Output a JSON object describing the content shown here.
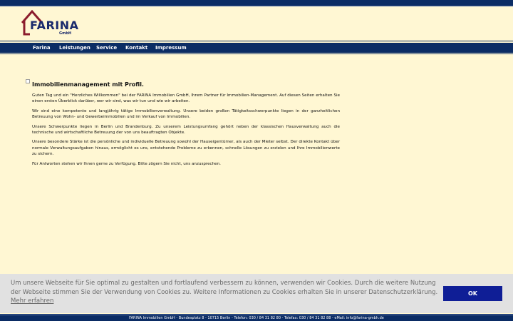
{
  "brand": {
    "name": "FARINA",
    "sub": "GmbH"
  },
  "nav": {
    "items": [
      {
        "label": "Farina"
      },
      {
        "label": "Leistungen"
      },
      {
        "label": "Service"
      },
      {
        "label": "Kontakt"
      },
      {
        "label": "Impressum"
      }
    ]
  },
  "content": {
    "heading": "Immobilienmanagement mit Profil.",
    "paragraphs": [
      "Guten Tag und ein \"Herzliches Willkommen\" bei der FARINA Immobilien GmbH, Ihrem Partner für Immobilien-Management. Auf diesen Seiten erhalten Sie einen ersten Überblick darüber, wer wir sind, was wir tun und wie wir arbeiten.",
      "Wir sind eine kompetente und langjährig tätige Immobilienverwaltung. Unsere beiden großen Tätigkeitsschwerpunkte liegen in der ganzheitlichen Betreuung von Wohn- und Gewerbeimmobilien und im Verkauf von Immobilien.",
      "Unsere Schwerpunkte liegen in Berlin und Brandenburg. Zu unserem Leistungsumfang gehört neben der klassischen Hausverwaltung auch die technische und wirtschaftliche Betreuung der von uns beauftragten Objekte.",
      "Unsere besondere Stärke ist die persönliche und individuelle Betreuung sowohl der Hauseigentümer, als auch der Mieter selbst. Der direkte Kontakt über normale Verwaltungsaufgaben hinaus, ermöglicht es uns, entstehende Probleme zu erkennen, schnelle Lösungen zu erzielen und Ihre Immobilienwerte zu sichern.",
      "Für Antworten stehen wir Ihnen gerne zu Verfügung. Bitte zögern Sie nicht, uns anzusprechen."
    ]
  },
  "cookie": {
    "text": "Um unsere Webseite für Sie optimal zu gestalten und fortlaufend verbessern zu können, verwenden wir Cookies. Durch die weitere Nutzung der Webseite stimmen Sie der Verwendung von Cookies zu. Weitere Informationen zu Cookies erhalten Sie in unserer Datenschutzerklärung.",
    "link": "Mehr erfahren",
    "ok_label": "OK"
  },
  "footer": {
    "text": "FARINA Immobilien GmbH - Bundesplatz 8 - 10715 Berlin - Telefon: 030 / 84 31 82 80 - Telefax: 030 / 84 31 82 88 - eMail: info@farina-gmbh.de"
  },
  "colors": {
    "navy": "#0b2c64",
    "background": "#fff7d3",
    "logo_red": "#8b1c2c",
    "button_blue": "#0f1e96"
  }
}
